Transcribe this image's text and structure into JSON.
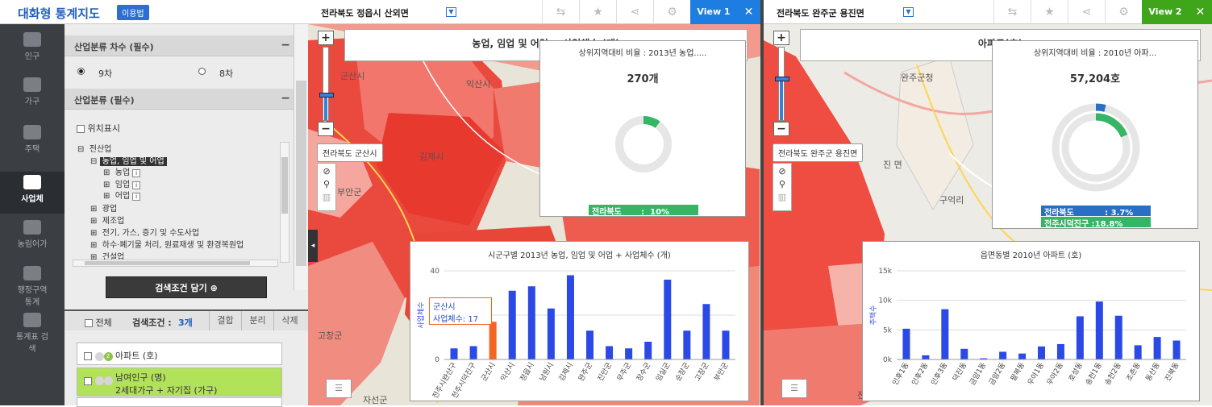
{
  "app": {
    "title": "대화형 통계지도",
    "usage_label": "이용법"
  },
  "side_menu": [
    {
      "label": "인구"
    },
    {
      "label": "가구"
    },
    {
      "label": "주택"
    },
    {
      "label": "사업체"
    },
    {
      "label": "농림어가"
    },
    {
      "label": "행정구역 통계"
    },
    {
      "label": "통계표 검색"
    }
  ],
  "panel": {
    "sec1_title": "산업분류 차수 (필수)",
    "opt1": "9차",
    "opt2": "8차",
    "sec2_title": "산업분류 (필수)",
    "location_label": "위치표시",
    "tree": [
      "전산업",
      "농업, 임업 및 어업",
      "농업",
      "임업",
      "어업",
      "광업",
      "제조업",
      "전기, 가스, 증기 및 수도사업",
      "하수·폐기물 처리, 원료재생 및 환경복원업",
      "건설업"
    ],
    "add_button": "검색조건 담기",
    "all_label": "전체",
    "cond_label": "검색조건 :",
    "cond_count": "3개",
    "btn_merge": "결합",
    "btn_split": "분리",
    "btn_delete": "삭제",
    "cond1": "아파트 (호)",
    "cond2_line1": "남여인구 (명)",
    "cond2_line2": "2세대가구 + 자기집 (가구)"
  },
  "view1": {
    "region": "전라북도 정읍시 산외면",
    "view_label": "View 1",
    "map_title": "농업, 임업 및 어업 + 사업체수 (개)",
    "place_label": "전라북도 군산시",
    "ratio_title": "상위지역대비 비율 : 2013년 농업.....",
    "ratio_value": "270개",
    "ratio_bar": "전라북도       :  10%",
    "ratio_fraction": 0.1,
    "map_names": [
      "군산시",
      "익산시",
      "김제시",
      "부안군",
      "고창군",
      "자선군"
    ],
    "chart_title": "시군구별 2013년 농업, 임업 및 어업 + 사업체수 (개)",
    "chart_ylabel": "사업체수",
    "tooltip_l1": "군산시",
    "tooltip_l2": "사업체수: 17"
  },
  "view2": {
    "region": "전라북도 완주군 용진면",
    "view_label": "View 2",
    "map_title": "아파트(호)",
    "place_label": "전라북도 완주군 용진면",
    "ratio_title": "상위지역대비 비율 : 2010년 아파...",
    "ratio_value": "57,204호",
    "ratio_bar1": "전라북도           : 3.7%",
    "ratio_bar2": "전주시덕진구 :18.8%",
    "ratio_fraction1": 0.037,
    "ratio_fraction2": 0.188,
    "map_names": [
      "완주군청",
      "구억리",
      "진 면",
      "전주시"
    ],
    "chart_title": "읍면동별 2010년 아파트 (호)",
    "chart_ylabel": "주택수"
  },
  "chart_data": [
    {
      "type": "bar",
      "title": "시군구별 2013년 농업, 임업 및 어업 + 사업체수 (개)",
      "ylabel": "사업체수",
      "xlabel": "",
      "ylim": [
        0,
        40
      ],
      "yticks": [
        "0",
        "20",
        "40"
      ],
      "categories": [
        "전주시완산구",
        "전주시덕진구",
        "군산시",
        "익산시",
        "정읍시",
        "남원시",
        "김제시",
        "완주군",
        "진안군",
        "무주군",
        "장수군",
        "임실군",
        "순창군",
        "고창군",
        "부안군"
      ],
      "values": [
        5,
        6,
        17,
        31,
        33,
        23,
        38,
        13,
        6,
        5,
        8,
        36,
        13,
        25,
        13
      ],
      "highlight_index": 2,
      "colors": {
        "bar": "#2b49e6",
        "highlight": "#f26522"
      }
    },
    {
      "type": "bar",
      "title": "읍면동별 2010년 아파트 (호)",
      "ylabel": "주택수",
      "xlabel": "",
      "ylim": [
        0,
        15000
      ],
      "yticks": [
        "0k",
        "5k",
        "10k",
        "15k"
      ],
      "categories": [
        "인후1동",
        "인후2동",
        "인후3동",
        "덕진동",
        "금암1동",
        "금암2동",
        "팔복동",
        "우아1동",
        "우아2동",
        "호성동",
        "송천1동",
        "송천2동",
        "조촌동",
        "동산동",
        "진북동"
      ],
      "values": [
        5200,
        700,
        8500,
        1800,
        200,
        1300,
        1000,
        2200,
        2600,
        7300,
        9800,
        7400,
        2400,
        3800,
        3200
      ],
      "colors": {
        "bar": "#2b49e6"
      }
    }
  ]
}
